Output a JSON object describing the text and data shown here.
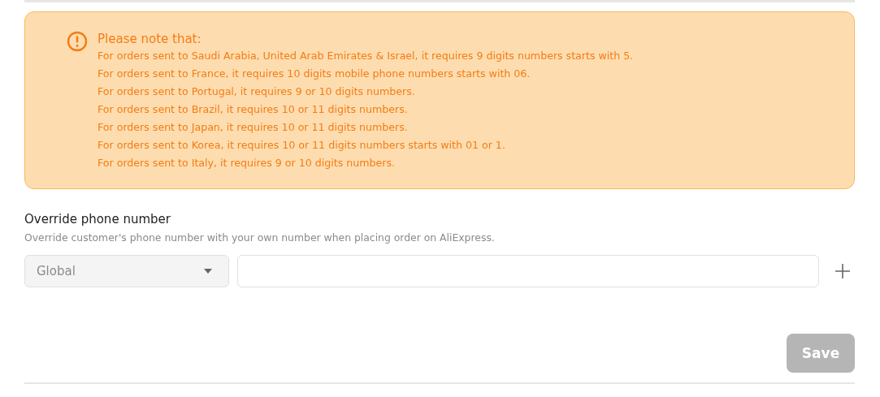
{
  "notice": {
    "title": "Please note that:",
    "lines": [
      "For orders sent to Saudi Arabia, United Arab Emirates & Israel, it requires 9 digits numbers starts with 5.",
      "For orders sent to France, it requires 10 digits mobile phone numbers starts with 06.",
      "For orders sent to Portugal, it requires 9 or 10 digits numbers.",
      "For orders sent to Brazil, it requires 10 or 11 digits numbers.",
      "For orders sent to Japan, it requires 10 or 11 digits numbers.",
      "For orders sent to Korea, it requires 10 or 11 digits numbers starts with 01 or 1.",
      "For orders sent to Italy, it requires 9 or 10 digits numbers."
    ]
  },
  "override": {
    "title": "Override phone number",
    "description": "Override customer's phone number with your own number when placing order on AliExpress.",
    "country_select": {
      "value": "Global"
    }
  },
  "save_button": {
    "label": "Save",
    "disabled": true
  }
}
